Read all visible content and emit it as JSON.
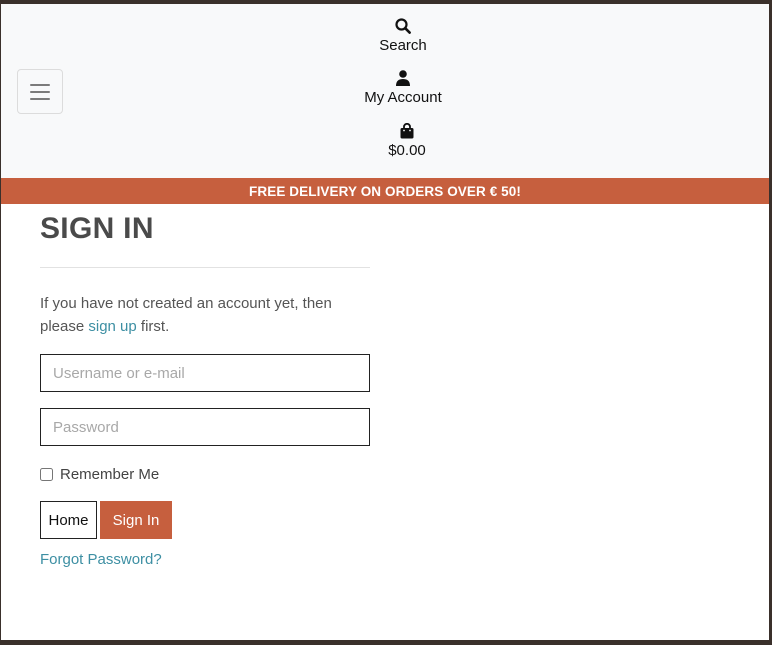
{
  "nav": {
    "search_label": "Search",
    "account_label": "My Account",
    "bag_total": "$0.00",
    "icons": [
      "search-icon",
      "user-icon",
      "shopping-bag-icon",
      "hamburger-menu-icon"
    ]
  },
  "banner": {
    "text": "FREE DELIVERY ON ORDERS OVER € 50!"
  },
  "signin": {
    "title": "SIGN IN",
    "intro_prefix": "If you have not created an account yet, then please ",
    "signup_link": "sign up",
    "intro_suffix": " first.",
    "username_placeholder": "Username or e-mail",
    "password_placeholder": "Password",
    "remember_label": "Remember Me",
    "home_button": "Home",
    "signin_button": "Sign In",
    "forgot_link": "Forgot Password?"
  },
  "colors": {
    "accent": "#c65f3e",
    "link": "#3d8fa3",
    "navbar_bg": "#f8f9fa"
  }
}
